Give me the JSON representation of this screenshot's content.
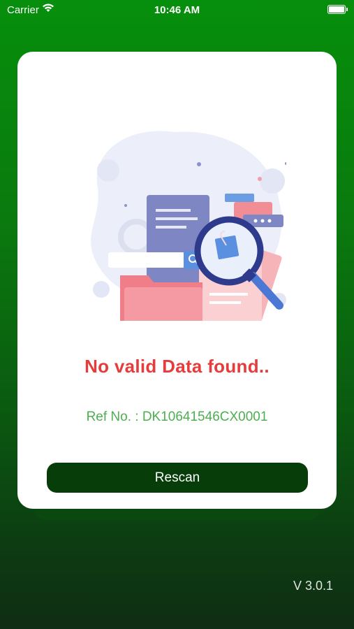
{
  "status_bar": {
    "carrier": "Carrier",
    "time": "10:46 AM"
  },
  "card": {
    "message": "No valid Data found..",
    "ref_label": "Ref No. : ",
    "ref_value": "DK10641546CX0001",
    "button_label": "Rescan"
  },
  "footer": {
    "version": "V 3.0.1"
  },
  "colors": {
    "background_top": "#068f0c",
    "background_bottom": "#0f2d14",
    "button": "#063d08",
    "message": "#e63c3c",
    "ref": "#4caf50"
  },
  "icons": [
    "wifi-icon",
    "battery-icon",
    "no-data-illustration"
  ]
}
